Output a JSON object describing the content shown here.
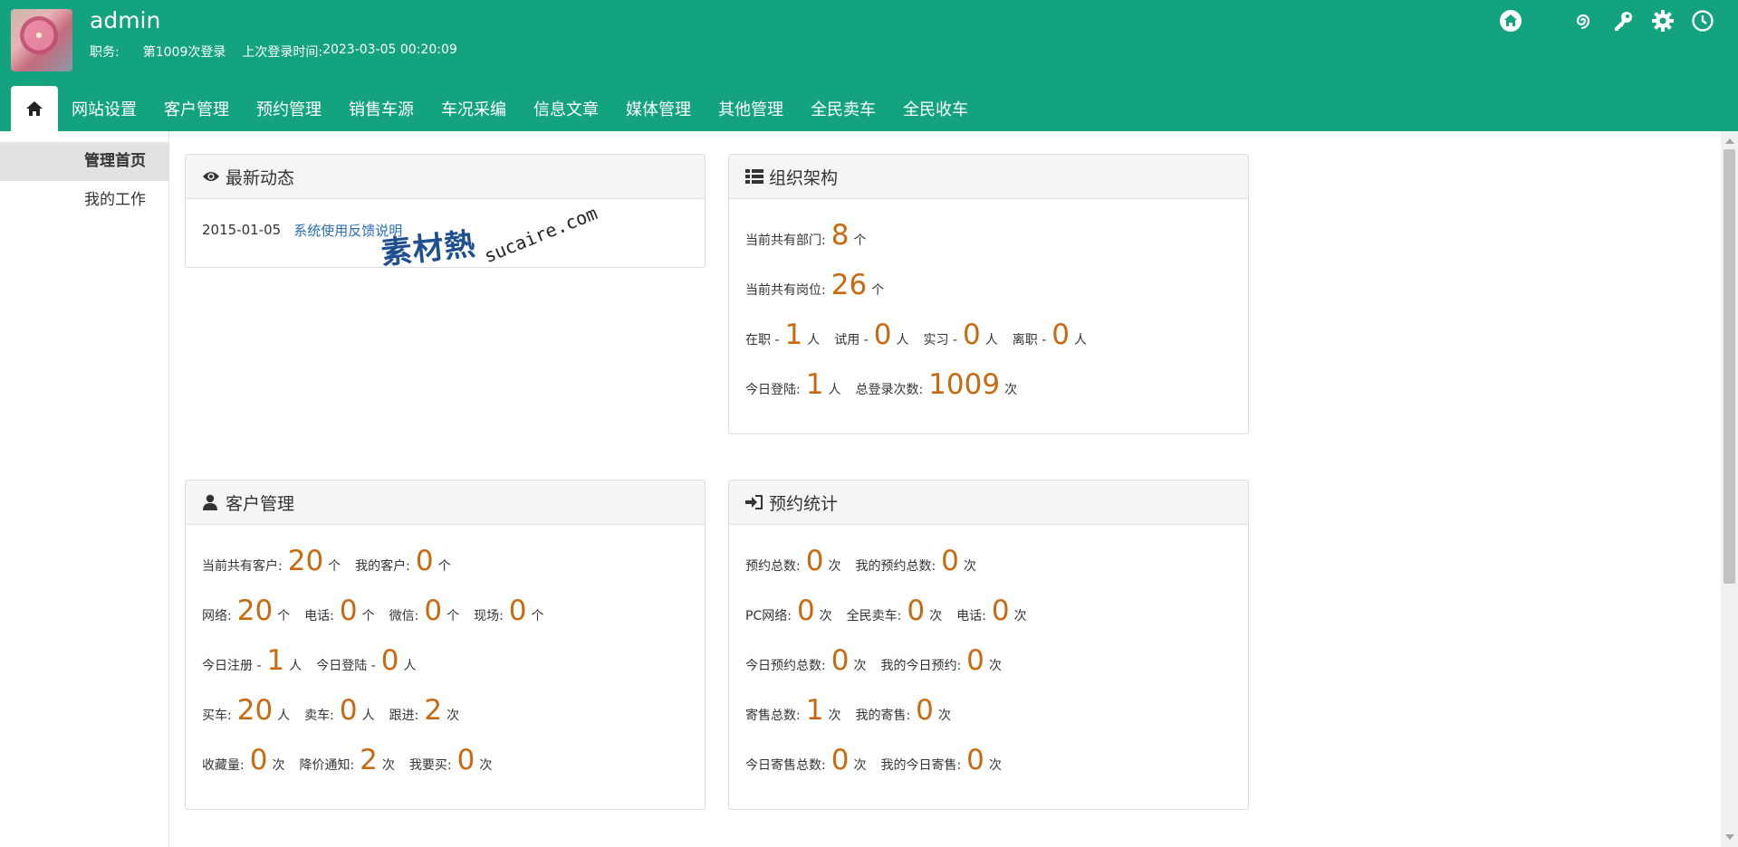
{
  "header": {
    "username": "admin",
    "role_label": "职务:",
    "login_count_text": "第1009次登录",
    "last_login_label": "上次登录时间:",
    "last_login_time": "2023-03-05 00:20:09",
    "bg_color": "#13a37e",
    "icons": [
      "home-circle-icon",
      "spiral-icon",
      "key-icon",
      "gear-icon",
      "clock-icon"
    ]
  },
  "nav": {
    "home_icon": "home-icon",
    "tabs": [
      "网站设置",
      "客户管理",
      "预约管理",
      "销售车源",
      "车况采编",
      "信息文章",
      "媒体管理",
      "其他管理",
      "全民卖车",
      "全民收车"
    ]
  },
  "sidebar": {
    "items": [
      {
        "label": "管理首页",
        "active": true
      },
      {
        "label": "我的工作",
        "active": false
      }
    ]
  },
  "panels": {
    "news": {
      "title": "最新动态",
      "items": [
        {
          "date": "2015-01-05",
          "title": "系统使用反馈说明"
        }
      ]
    },
    "org": {
      "title": "组织架构",
      "lines": [
        [
          {
            "label": "当前共有部门:",
            "value": "8",
            "unit": "个"
          }
        ],
        [
          {
            "label": "当前共有岗位:",
            "value": "26",
            "unit": "个"
          }
        ],
        [
          {
            "label": "在职 -",
            "value": "1",
            "unit": "人"
          },
          {
            "label": "试用 -",
            "value": "0",
            "unit": "人"
          },
          {
            "label": "实习 -",
            "value": "0",
            "unit": "人"
          },
          {
            "label": "离职 -",
            "value": "0",
            "unit": "人"
          }
        ],
        [
          {
            "label": "今日登陆:",
            "value": "1",
            "unit": "人"
          },
          {
            "label": "总登录次数:",
            "value": "1009",
            "unit": "次"
          }
        ]
      ]
    },
    "customer": {
      "title": "客户管理",
      "lines": [
        [
          {
            "label": "当前共有客户:",
            "value": "20",
            "unit": "个"
          },
          {
            "label": "我的客户:",
            "value": "0",
            "unit": "个"
          }
        ],
        [
          {
            "label": "网络:",
            "value": "20",
            "unit": "个"
          },
          {
            "label": "电话:",
            "value": "0",
            "unit": "个"
          },
          {
            "label": "微信:",
            "value": "0",
            "unit": "个"
          },
          {
            "label": "现场:",
            "value": "0",
            "unit": "个"
          }
        ],
        [
          {
            "label": "今日注册 -",
            "value": "1",
            "unit": "人"
          },
          {
            "label": "今日登陆 -",
            "value": "0",
            "unit": "人"
          }
        ],
        [
          {
            "label": "买车:",
            "value": "20",
            "unit": "人"
          },
          {
            "label": "卖车:",
            "value": "0",
            "unit": "人"
          },
          {
            "label": "跟进:",
            "value": "2",
            "unit": "次"
          }
        ],
        [
          {
            "label": "收藏量:",
            "value": "0",
            "unit": "次"
          },
          {
            "label": "降价通知:",
            "value": "2",
            "unit": "次"
          },
          {
            "label": "我要买:",
            "value": "0",
            "unit": "次"
          }
        ]
      ]
    },
    "booking": {
      "title": "预约统计",
      "lines": [
        [
          {
            "label": "预约总数:",
            "value": "0",
            "unit": "次"
          },
          {
            "label": "我的预约总数:",
            "value": "0",
            "unit": "次"
          }
        ],
        [
          {
            "label": "PC网络:",
            "value": "0",
            "unit": "次"
          },
          {
            "label": "全民卖车:",
            "value": "0",
            "unit": "次"
          },
          {
            "label": "电话:",
            "value": "0",
            "unit": "次"
          }
        ],
        [
          {
            "label": "今日预约总数:",
            "value": "0",
            "unit": "次"
          },
          {
            "label": "我的今日预约:",
            "value": "0",
            "unit": "次"
          }
        ],
        [
          {
            "label": "寄售总数:",
            "value": "1",
            "unit": "次"
          },
          {
            "label": "我的寄售:",
            "value": "0",
            "unit": "次"
          }
        ],
        [
          {
            "label": "今日寄售总数:",
            "value": "0",
            "unit": "次"
          },
          {
            "label": "我的今日寄售:",
            "value": "0",
            "unit": "次"
          }
        ]
      ]
    }
  },
  "watermark": {
    "cn": "素材熱",
    "en": "sucaire.com"
  },
  "colors": {
    "accent": "#13a37e",
    "number": "#c9690f",
    "link": "#2b6bb0"
  }
}
